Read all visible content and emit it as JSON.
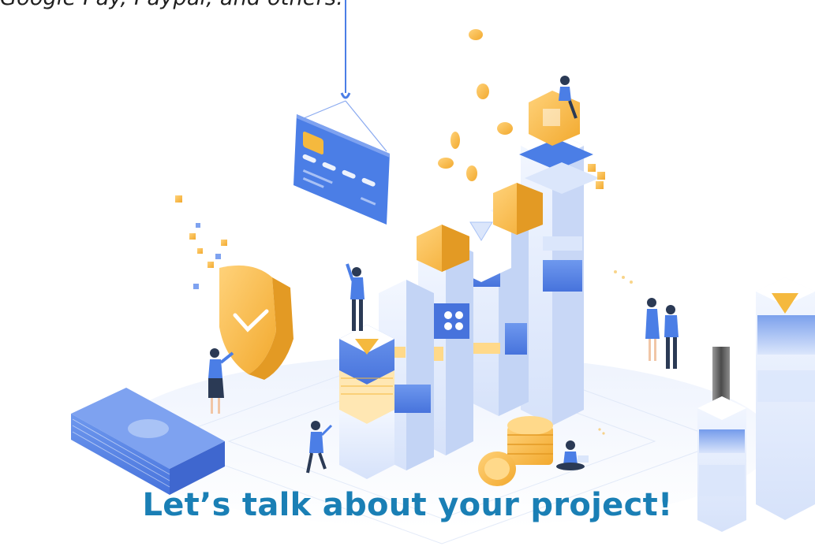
{
  "intro": {
    "text": "Google Pay, Paypal, and others."
  },
  "hero": {
    "heading": "Let’s talk about your project!",
    "heading_color": "#1a7fb5"
  },
  "illustration": {
    "icons": [
      "credit-card-icon",
      "shield-check-icon",
      "money-stack-icon",
      "coin-stack-icon",
      "crane-hook-icon",
      "diamond-icon"
    ],
    "colors": {
      "primary_blue": "#4b7ee6",
      "light_blue": "#dbe6fb",
      "gold": "#f5b93e",
      "light_gold": "#ffd98a"
    }
  }
}
